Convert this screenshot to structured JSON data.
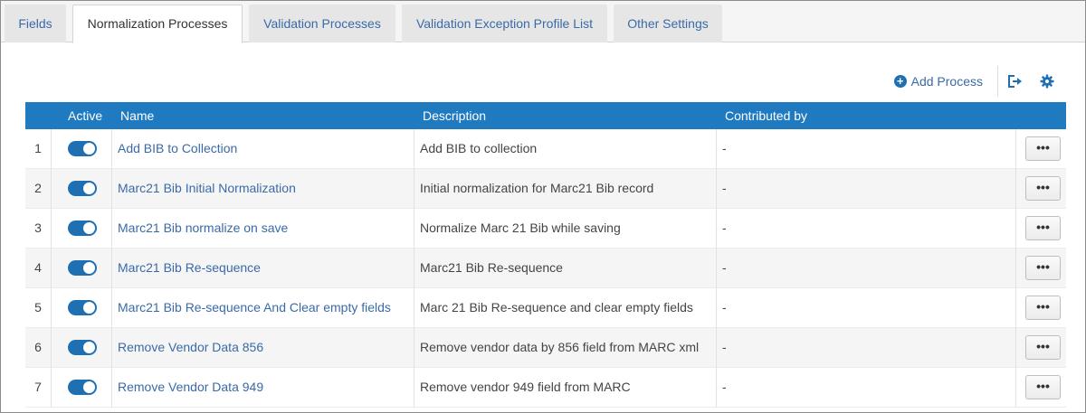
{
  "tabs": [
    {
      "label": "Fields",
      "active": false
    },
    {
      "label": "Normalization Processes",
      "active": true
    },
    {
      "label": "Validation Processes",
      "active": false
    },
    {
      "label": "Validation Exception Profile List",
      "active": false
    },
    {
      "label": "Other Settings",
      "active": false
    }
  ],
  "toolbar": {
    "add_process_label": "Add Process",
    "icons": [
      "plus-circle-icon",
      "export-icon",
      "gear-icon"
    ]
  },
  "table": {
    "headers": {
      "number": "",
      "active": "Active",
      "name": "Name",
      "description": "Description",
      "contributed_by": "Contributed by"
    },
    "rows": [
      {
        "num": "1",
        "active": true,
        "name": "Add BIB to Collection",
        "description": "Add BIB to collection",
        "contributed_by": "-"
      },
      {
        "num": "2",
        "active": true,
        "name": "Marc21 Bib Initial Normalization",
        "description": "Initial normalization for Marc21 Bib record",
        "contributed_by": "-"
      },
      {
        "num": "3",
        "active": true,
        "name": "Marc21 Bib normalize on save",
        "description": "Normalize Marc 21 Bib while saving",
        "contributed_by": "-"
      },
      {
        "num": "4",
        "active": true,
        "name": "Marc21 Bib Re-sequence",
        "description": "Marc21 Bib Re-sequence",
        "contributed_by": "-"
      },
      {
        "num": "5",
        "active": true,
        "name": "Marc21 Bib Re-sequence And Clear empty fields",
        "description": "Marc 21 Bib Re-sequence and clear empty fields",
        "contributed_by": "-"
      },
      {
        "num": "6",
        "active": true,
        "name": "Remove Vendor Data 856",
        "description": "Remove vendor data by 856 field from MARC xml",
        "contributed_by": "-"
      },
      {
        "num": "7",
        "active": true,
        "name": "Remove Vendor Data 949",
        "description": "Remove vendor 949 field from MARC",
        "contributed_by": "-"
      }
    ],
    "row_action_label": "•••"
  },
  "colors": {
    "header_bg": "#1f7ac0",
    "link": "#3a6aa8",
    "toggle_on": "#1f6fb3",
    "tab_bg": "#e6e6e6"
  }
}
